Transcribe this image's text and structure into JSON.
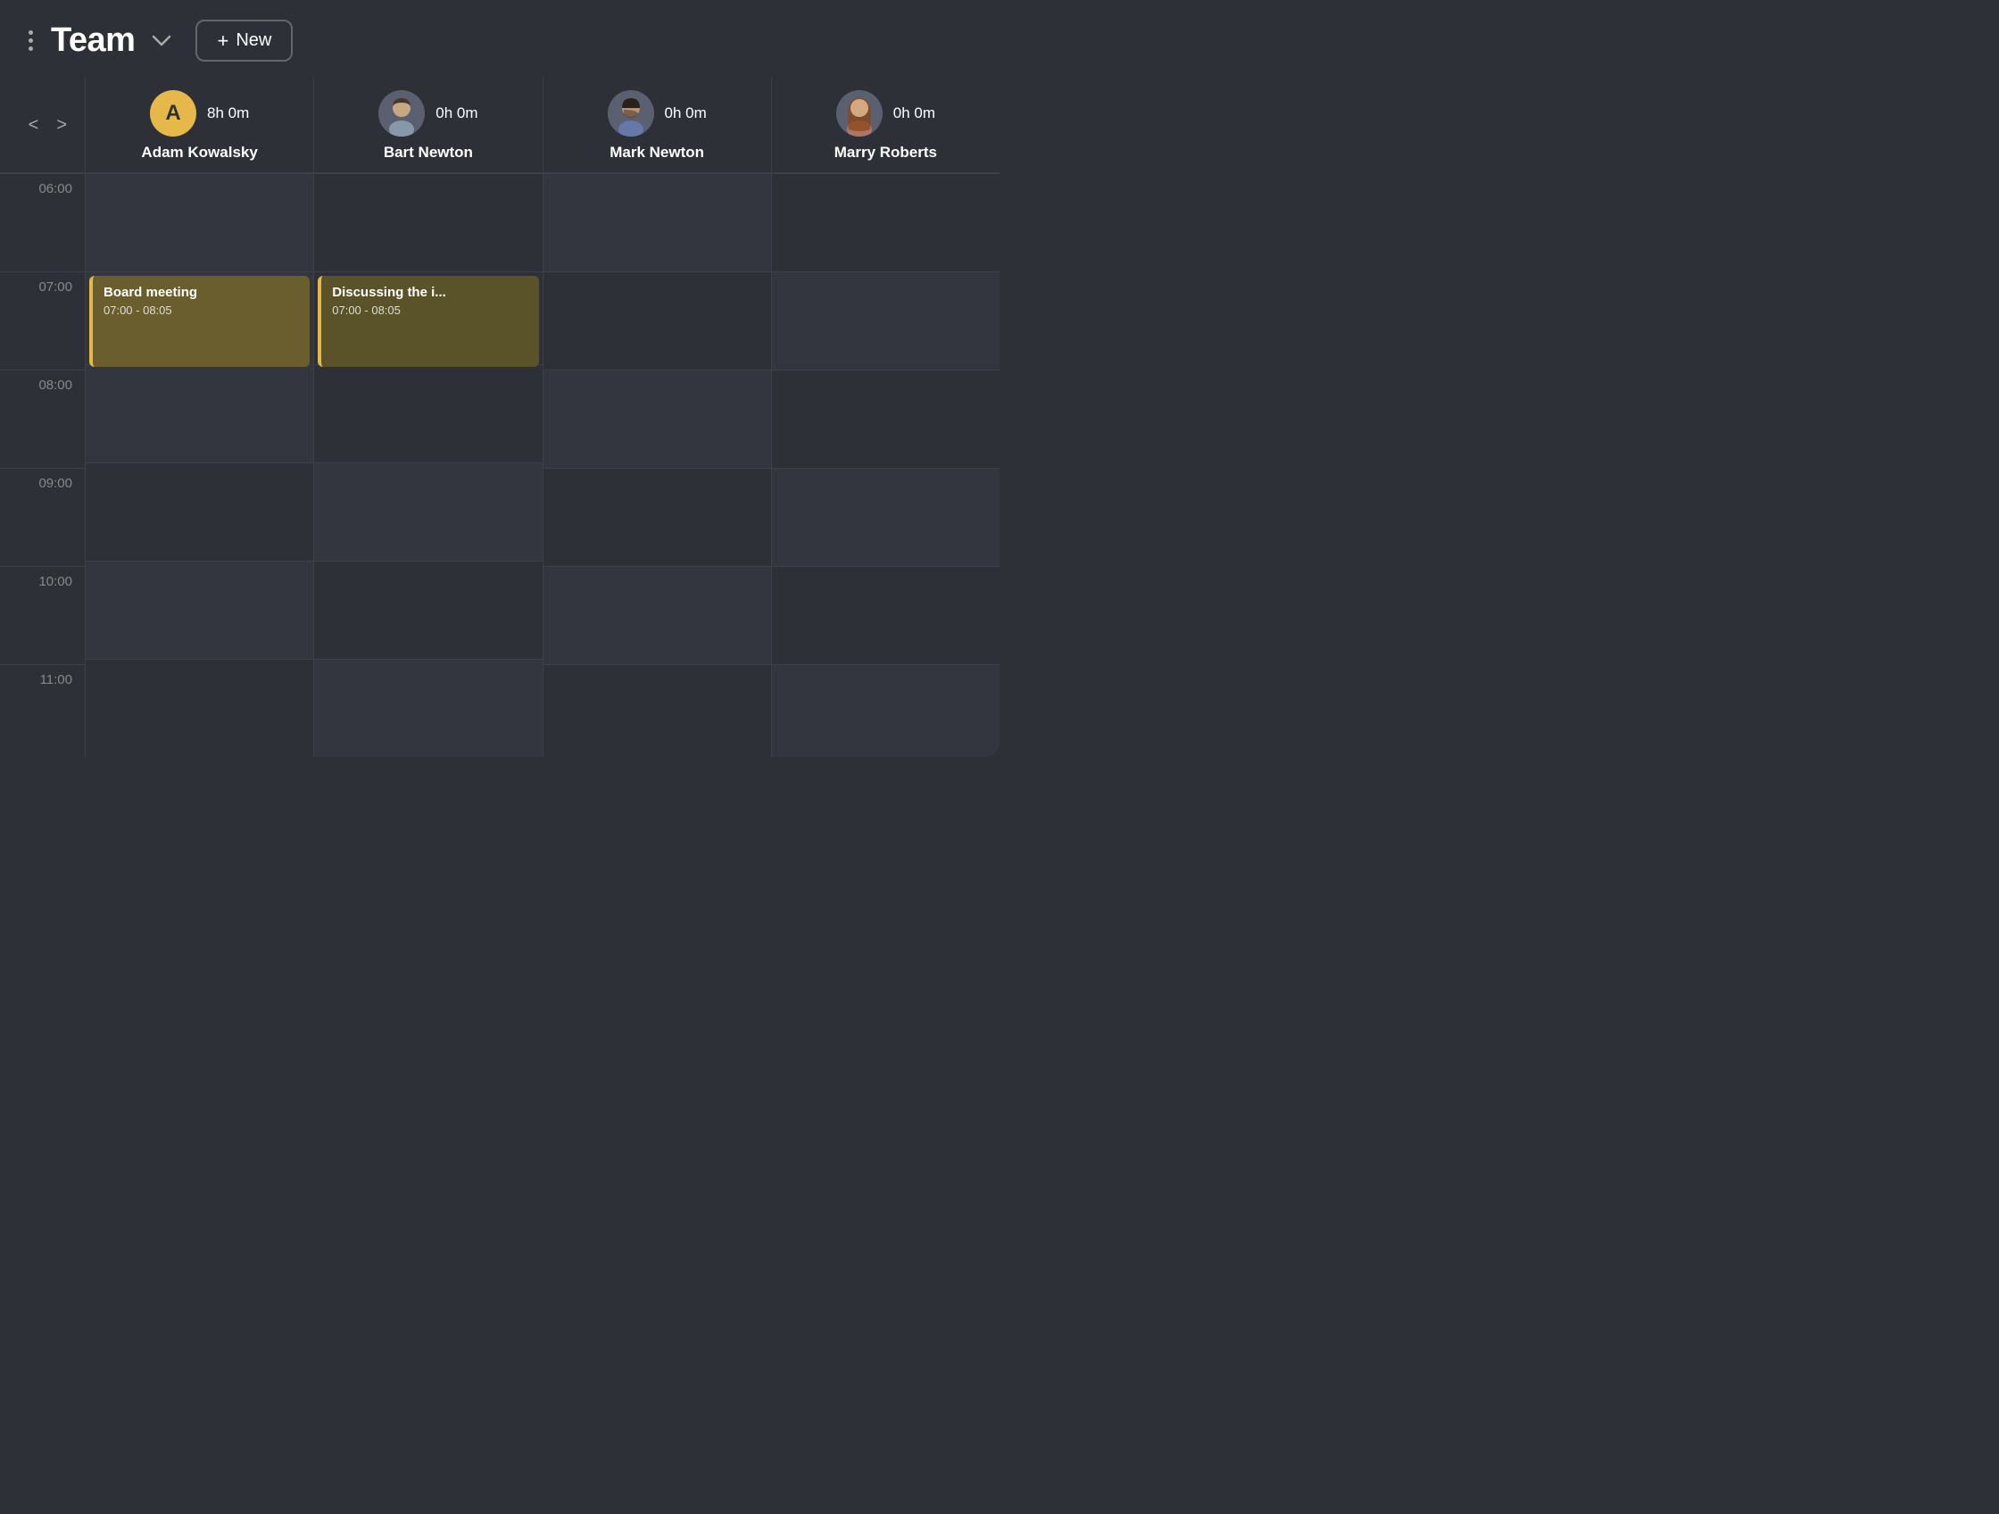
{
  "header": {
    "title": "Team",
    "new_label": "New",
    "menu_icon": "⋮",
    "chevron_icon": "˅"
  },
  "nav": {
    "prev_label": "<",
    "next_label": ">"
  },
  "members": [
    {
      "id": "adam",
      "name": "Adam Kowalsky",
      "hours": "8h 0m",
      "avatar_type": "initials",
      "initials": "A",
      "avatar_color": "#e6b84a"
    },
    {
      "id": "bart",
      "name": "Bart Newton",
      "hours": "0h 0m",
      "avatar_type": "photo",
      "avatar_desc": "woman with short hair"
    },
    {
      "id": "mark",
      "name": "Mark Newton",
      "hours": "0h 0m",
      "avatar_type": "photo",
      "avatar_desc": "man with beard"
    },
    {
      "id": "marry",
      "name": "Marry Roberts",
      "hours": "0h 0m",
      "avatar_type": "photo",
      "avatar_desc": "woman with long hair"
    }
  ],
  "time_slots": [
    "06:00",
    "07:00",
    "08:00",
    "09:00",
    "10:00",
    "11:00"
  ],
  "events": {
    "adam_07": {
      "title": "Board meeting",
      "time": "07:00 - 08:05",
      "col": 0,
      "row": 1
    },
    "bart_07": {
      "title": "Discussing the i...",
      "time": "07:00 - 08:05",
      "col": 1,
      "row": 1
    }
  }
}
